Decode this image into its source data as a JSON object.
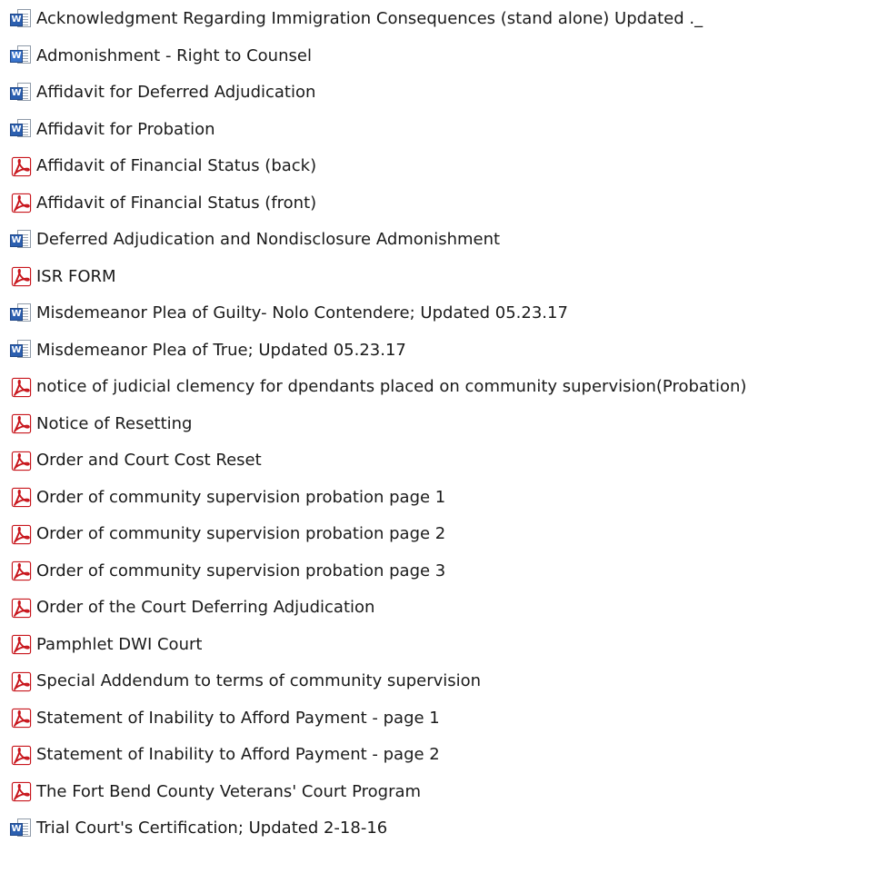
{
  "files": [
    {
      "type": "word",
      "icon": "word-document-icon",
      "name": "Acknowledgment Regarding Immigration Consequences (stand alone) Updated ._"
    },
    {
      "type": "word",
      "icon": "word-document-icon",
      "name": "Admonishment - Right to Counsel"
    },
    {
      "type": "word",
      "icon": "word-document-icon",
      "name": "Affidavit for Deferred Adjudication"
    },
    {
      "type": "word",
      "icon": "word-document-icon",
      "name": "Affidavit for Probation"
    },
    {
      "type": "pdf",
      "icon": "pdf-document-icon",
      "name": "Affidavit of Financial Status (back)"
    },
    {
      "type": "pdf",
      "icon": "pdf-document-icon",
      "name": "Affidavit of Financial Status (front)"
    },
    {
      "type": "word",
      "icon": "word-document-icon",
      "name": "Deferred Adjudication and Nondisclosure Admonishment"
    },
    {
      "type": "pdf",
      "icon": "pdf-document-icon",
      "name": "ISR FORM"
    },
    {
      "type": "word",
      "icon": "word-document-icon",
      "name": "Misdemeanor Plea of Guilty- Nolo Contendere; Updated 05.23.17"
    },
    {
      "type": "word",
      "icon": "word-document-icon",
      "name": "Misdemeanor Plea of True; Updated 05.23.17"
    },
    {
      "type": "pdf",
      "icon": "pdf-document-icon",
      "name": "notice of judicial clemency for dpendants placed on community supervision(Probation)"
    },
    {
      "type": "pdf",
      "icon": "pdf-document-icon",
      "name": "Notice of Resetting"
    },
    {
      "type": "pdf",
      "icon": "pdf-document-icon",
      "name": "Order and Court Cost Reset"
    },
    {
      "type": "pdf",
      "icon": "pdf-document-icon",
      "name": "Order of community supervision probation page 1"
    },
    {
      "type": "pdf",
      "icon": "pdf-document-icon",
      "name": "Order of community supervision probation page 2"
    },
    {
      "type": "pdf",
      "icon": "pdf-document-icon",
      "name": "Order of community supervision probation page 3"
    },
    {
      "type": "pdf",
      "icon": "pdf-document-icon",
      "name": "Order of the Court Deferring Adjudication"
    },
    {
      "type": "pdf",
      "icon": "pdf-document-icon",
      "name": "Pamphlet DWI Court"
    },
    {
      "type": "pdf",
      "icon": "pdf-document-icon",
      "name": "Special Addendum to terms of community supervision"
    },
    {
      "type": "pdf",
      "icon": "pdf-document-icon",
      "name": "Statement of Inability to Afford Payment - page 1"
    },
    {
      "type": "pdf",
      "icon": "pdf-document-icon",
      "name": "Statement of Inability to Afford Payment - page 2"
    },
    {
      "type": "pdf",
      "icon": "pdf-document-icon",
      "name": "The Fort Bend County Veterans' Court Program"
    },
    {
      "type": "word",
      "icon": "word-document-icon",
      "name": "Trial Court's Certification; Updated 2-18-16"
    }
  ],
  "colors": {
    "word_badge": "#2b5fb0",
    "pdf_red": "#c8161d",
    "text": "#1a1a1a",
    "background": "#ffffff"
  }
}
